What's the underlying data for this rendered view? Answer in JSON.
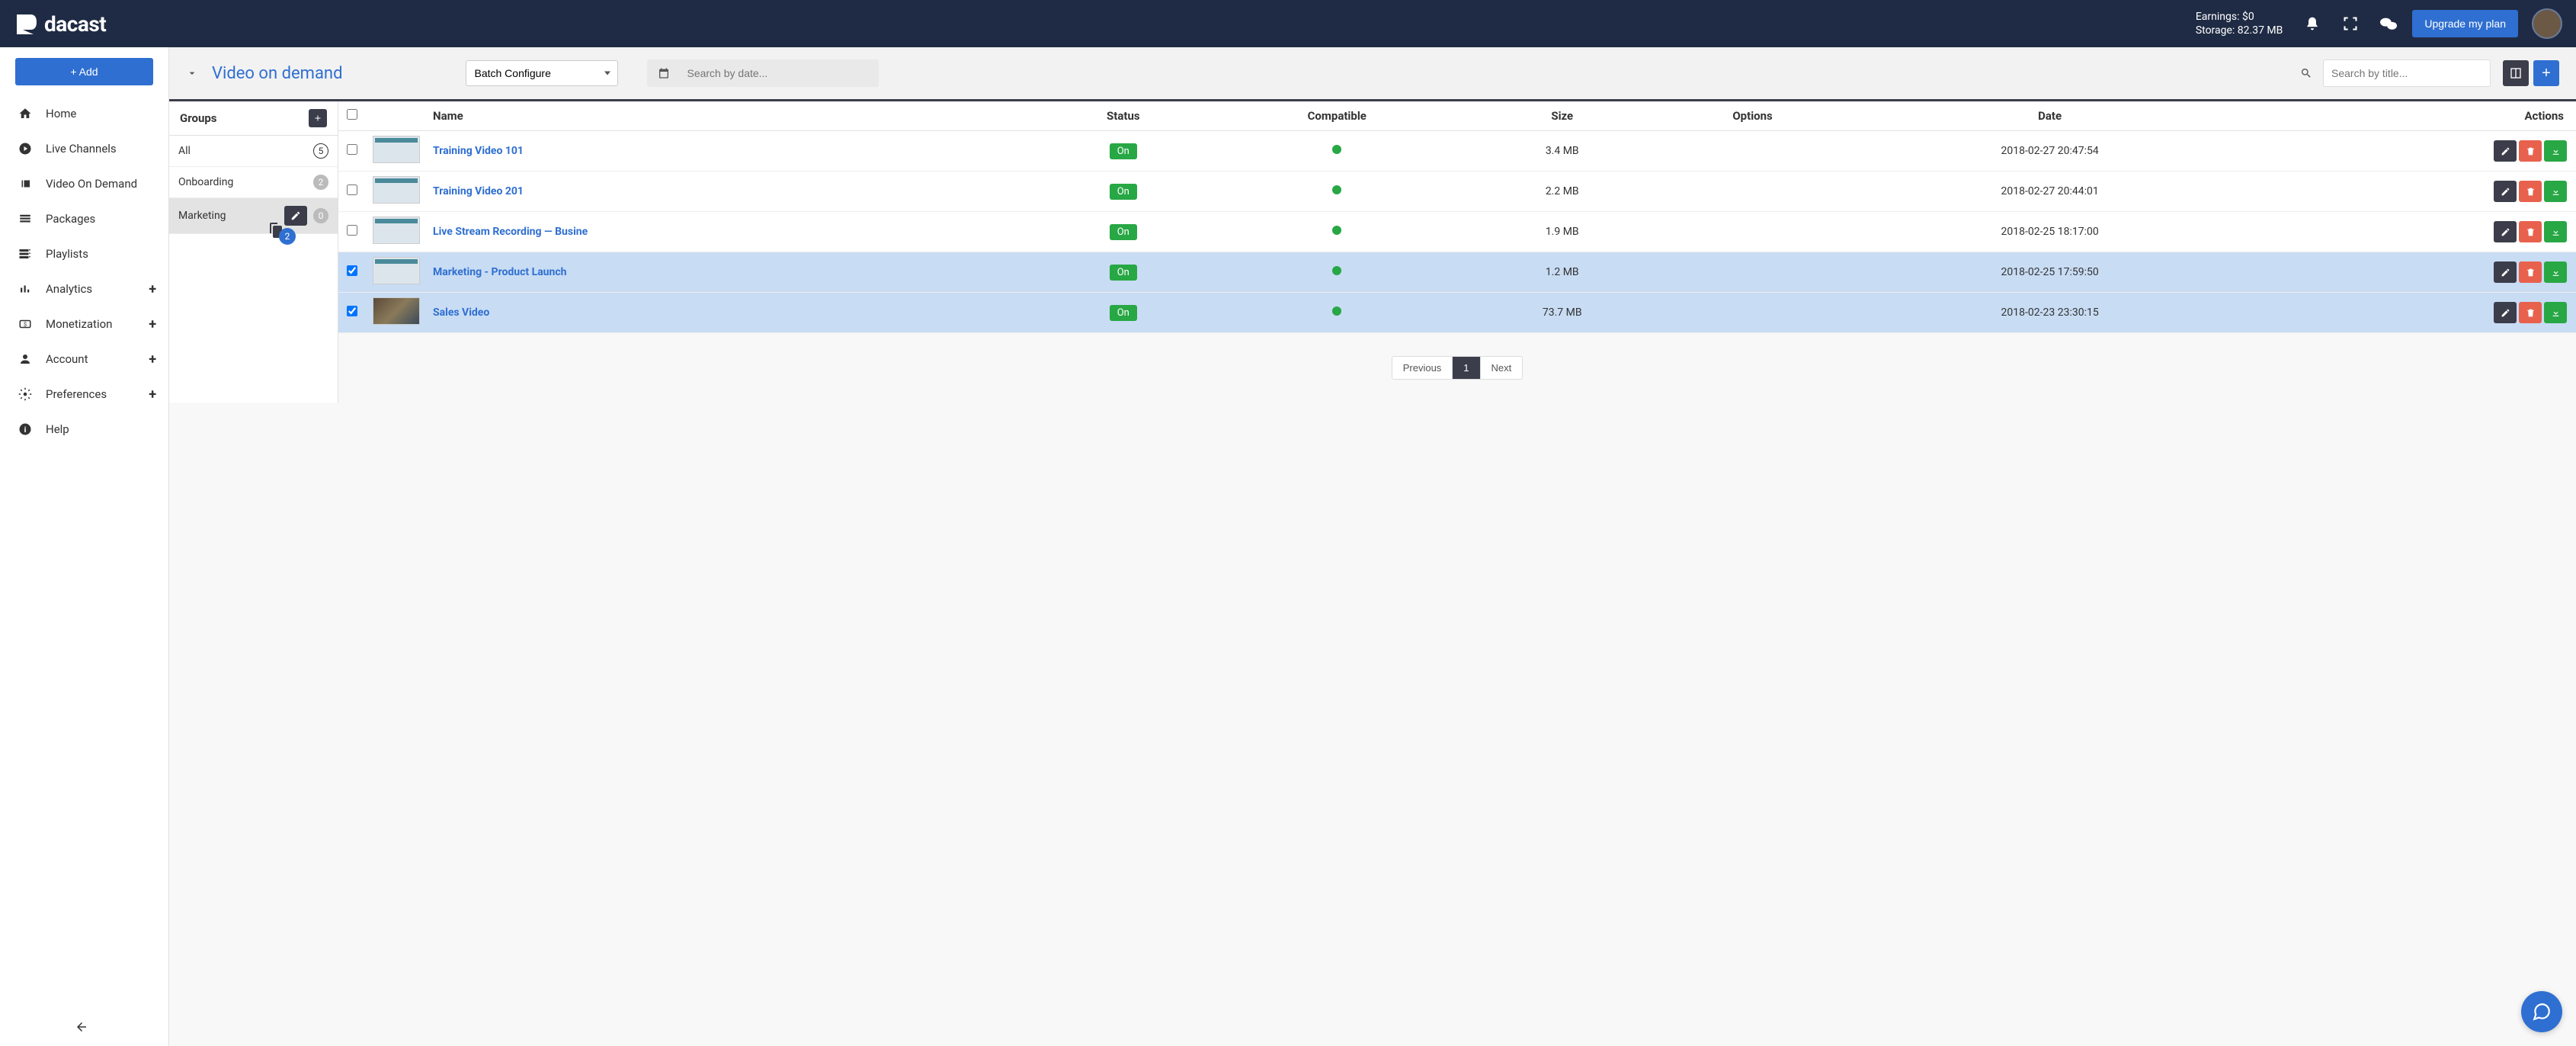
{
  "header": {
    "brand": "dacast",
    "earnings_label": "Earnings: $0",
    "storage_label": "Storage: 82.37 MB",
    "upgrade_label": "Upgrade my plan"
  },
  "sidebar": {
    "add_label": "+ Add",
    "items": [
      {
        "label": "Home"
      },
      {
        "label": "Live Channels"
      },
      {
        "label": "Video On Demand"
      },
      {
        "label": "Packages"
      },
      {
        "label": "Playlists"
      },
      {
        "label": "Analytics",
        "expandable": true
      },
      {
        "label": "Monetization",
        "expandable": true
      },
      {
        "label": " Account",
        "expandable": true
      },
      {
        "label": "Preferences",
        "expandable": true
      },
      {
        "label": "Help"
      }
    ]
  },
  "toolbar": {
    "page_title": "Video on demand",
    "batch_label": "Batch Configure",
    "search_date_placeholder": "Search by date...",
    "search_title_placeholder": "Search by title..."
  },
  "groups": {
    "header": "Groups",
    "items": [
      {
        "name": "All",
        "count": "5",
        "style": "outline"
      },
      {
        "name": "Onboarding",
        "count": "2",
        "style": "gray"
      },
      {
        "name": "Marketing",
        "count": "0",
        "style": "gray",
        "active": true
      }
    ],
    "drag_count": "2"
  },
  "table": {
    "columns": {
      "name": "Name",
      "status": "Status",
      "compatible": "Compatible",
      "size": "Size",
      "options": "Options",
      "date": "Date",
      "actions": "Actions"
    },
    "rows": [
      {
        "selected": false,
        "name": "Training Video 101",
        "status": "On",
        "size": "3.4 MB",
        "date": "2018-02-27 20:47:54",
        "thumb": "thumb"
      },
      {
        "selected": false,
        "name": "Training Video 201",
        "status": "On",
        "size": "2.2 MB",
        "date": "2018-02-27 20:44:01",
        "thumb": "thumb"
      },
      {
        "selected": false,
        "name": "Live Stream Recording — Busine",
        "status": "On",
        "size": "1.9 MB",
        "date": "2018-02-25 18:17:00",
        "thumb": "thumb"
      },
      {
        "selected": true,
        "name": "Marketing - Product Launch",
        "status": "On",
        "size": "1.2 MB",
        "date": "2018-02-25 17:59:50",
        "thumb": "thumb"
      },
      {
        "selected": true,
        "name": "Sales Video",
        "status": "On",
        "size": "73.7 MB",
        "date": "2018-02-23 23:30:15",
        "thumb": "img"
      }
    ]
  },
  "pagination": {
    "prev": "Previous",
    "page": "1",
    "next": "Next"
  }
}
